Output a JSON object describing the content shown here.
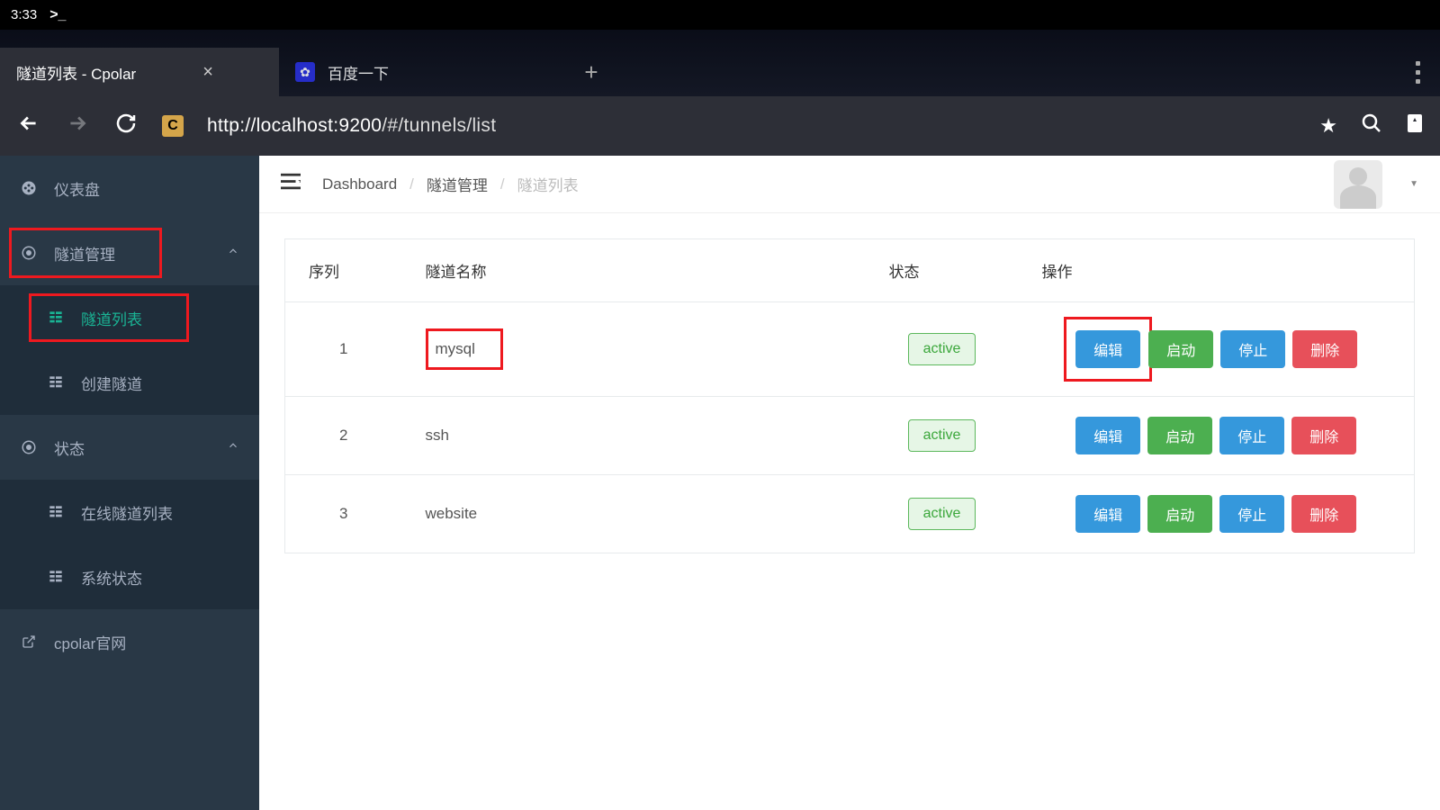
{
  "status_bar": {
    "time": "3:33",
    "prompt": ">_"
  },
  "browser": {
    "tabs": [
      {
        "title": "隧道列表 - Cpolar",
        "active": true
      },
      {
        "title": "百度一下",
        "active": false
      }
    ],
    "url_host": "http://localhost:9200",
    "url_path": "/#/tunnels/list",
    "site_badge": "C"
  },
  "sidebar": {
    "items": [
      {
        "icon": "dashboard",
        "label": "仪表盘"
      },
      {
        "icon": "target",
        "label": "隧道管理",
        "expandable": true,
        "highlight": true,
        "children": [
          {
            "icon": "grid",
            "label": "隧道列表",
            "active": true,
            "highlight": true
          },
          {
            "icon": "grid",
            "label": "创建隧道"
          }
        ]
      },
      {
        "icon": "target",
        "label": "状态",
        "expandable": true,
        "children": [
          {
            "icon": "grid",
            "label": "在线隧道列表"
          },
          {
            "icon": "grid",
            "label": "系统状态"
          }
        ]
      },
      {
        "icon": "external",
        "label": "cpolar官网"
      }
    ]
  },
  "breadcrumb": {
    "items": [
      "Dashboard",
      "隧道管理",
      "隧道列表"
    ]
  },
  "table": {
    "headers": {
      "seq": "序列",
      "name": "隧道名称",
      "status": "状态",
      "action": "操作"
    },
    "action_labels": {
      "edit": "编辑",
      "start": "启动",
      "stop": "停止",
      "delete": "删除"
    },
    "rows": [
      {
        "seq": "1",
        "name": "mysql",
        "status": "active",
        "highlight_name": true,
        "highlight_edit": true
      },
      {
        "seq": "2",
        "name": "ssh",
        "status": "active"
      },
      {
        "seq": "3",
        "name": "website",
        "status": "active"
      }
    ]
  }
}
